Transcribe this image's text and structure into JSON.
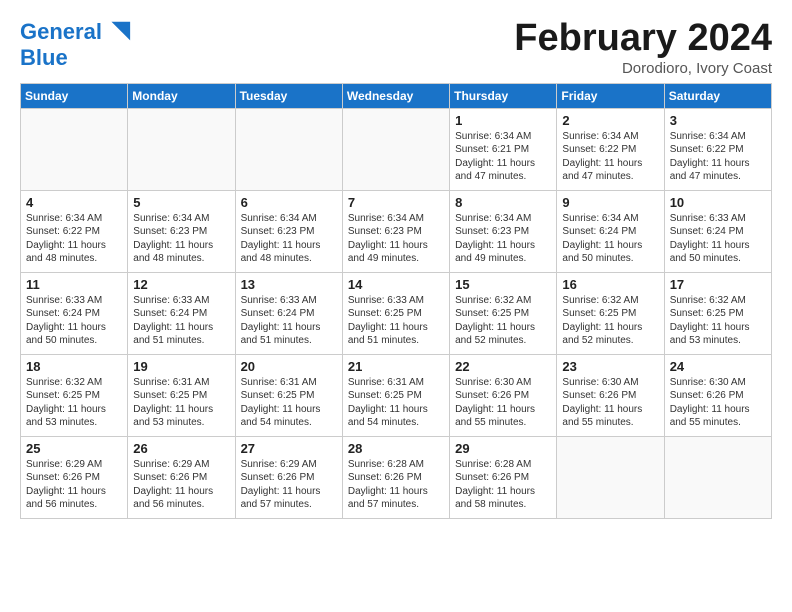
{
  "logo": {
    "line1": "General",
    "line2": "Blue"
  },
  "title": "February 2024",
  "subtitle": "Dorodioro, Ivory Coast",
  "headers": [
    "Sunday",
    "Monday",
    "Tuesday",
    "Wednesday",
    "Thursday",
    "Friday",
    "Saturday"
  ],
  "weeks": [
    [
      {
        "day": "",
        "info": ""
      },
      {
        "day": "",
        "info": ""
      },
      {
        "day": "",
        "info": ""
      },
      {
        "day": "",
        "info": ""
      },
      {
        "day": "1",
        "info": "Sunrise: 6:34 AM\nSunset: 6:21 PM\nDaylight: 11 hours\nand 47 minutes."
      },
      {
        "day": "2",
        "info": "Sunrise: 6:34 AM\nSunset: 6:22 PM\nDaylight: 11 hours\nand 47 minutes."
      },
      {
        "day": "3",
        "info": "Sunrise: 6:34 AM\nSunset: 6:22 PM\nDaylight: 11 hours\nand 47 minutes."
      }
    ],
    [
      {
        "day": "4",
        "info": "Sunrise: 6:34 AM\nSunset: 6:22 PM\nDaylight: 11 hours\nand 48 minutes."
      },
      {
        "day": "5",
        "info": "Sunrise: 6:34 AM\nSunset: 6:23 PM\nDaylight: 11 hours\nand 48 minutes."
      },
      {
        "day": "6",
        "info": "Sunrise: 6:34 AM\nSunset: 6:23 PM\nDaylight: 11 hours\nand 48 minutes."
      },
      {
        "day": "7",
        "info": "Sunrise: 6:34 AM\nSunset: 6:23 PM\nDaylight: 11 hours\nand 49 minutes."
      },
      {
        "day": "8",
        "info": "Sunrise: 6:34 AM\nSunset: 6:23 PM\nDaylight: 11 hours\nand 49 minutes."
      },
      {
        "day": "9",
        "info": "Sunrise: 6:34 AM\nSunset: 6:24 PM\nDaylight: 11 hours\nand 50 minutes."
      },
      {
        "day": "10",
        "info": "Sunrise: 6:33 AM\nSunset: 6:24 PM\nDaylight: 11 hours\nand 50 minutes."
      }
    ],
    [
      {
        "day": "11",
        "info": "Sunrise: 6:33 AM\nSunset: 6:24 PM\nDaylight: 11 hours\nand 50 minutes."
      },
      {
        "day": "12",
        "info": "Sunrise: 6:33 AM\nSunset: 6:24 PM\nDaylight: 11 hours\nand 51 minutes."
      },
      {
        "day": "13",
        "info": "Sunrise: 6:33 AM\nSunset: 6:24 PM\nDaylight: 11 hours\nand 51 minutes."
      },
      {
        "day": "14",
        "info": "Sunrise: 6:33 AM\nSunset: 6:25 PM\nDaylight: 11 hours\nand 51 minutes."
      },
      {
        "day": "15",
        "info": "Sunrise: 6:32 AM\nSunset: 6:25 PM\nDaylight: 11 hours\nand 52 minutes."
      },
      {
        "day": "16",
        "info": "Sunrise: 6:32 AM\nSunset: 6:25 PM\nDaylight: 11 hours\nand 52 minutes."
      },
      {
        "day": "17",
        "info": "Sunrise: 6:32 AM\nSunset: 6:25 PM\nDaylight: 11 hours\nand 53 minutes."
      }
    ],
    [
      {
        "day": "18",
        "info": "Sunrise: 6:32 AM\nSunset: 6:25 PM\nDaylight: 11 hours\nand 53 minutes."
      },
      {
        "day": "19",
        "info": "Sunrise: 6:31 AM\nSunset: 6:25 PM\nDaylight: 11 hours\nand 53 minutes."
      },
      {
        "day": "20",
        "info": "Sunrise: 6:31 AM\nSunset: 6:25 PM\nDaylight: 11 hours\nand 54 minutes."
      },
      {
        "day": "21",
        "info": "Sunrise: 6:31 AM\nSunset: 6:25 PM\nDaylight: 11 hours\nand 54 minutes."
      },
      {
        "day": "22",
        "info": "Sunrise: 6:30 AM\nSunset: 6:26 PM\nDaylight: 11 hours\nand 55 minutes."
      },
      {
        "day": "23",
        "info": "Sunrise: 6:30 AM\nSunset: 6:26 PM\nDaylight: 11 hours\nand 55 minutes."
      },
      {
        "day": "24",
        "info": "Sunrise: 6:30 AM\nSunset: 6:26 PM\nDaylight: 11 hours\nand 55 minutes."
      }
    ],
    [
      {
        "day": "25",
        "info": "Sunrise: 6:29 AM\nSunset: 6:26 PM\nDaylight: 11 hours\nand 56 minutes."
      },
      {
        "day": "26",
        "info": "Sunrise: 6:29 AM\nSunset: 6:26 PM\nDaylight: 11 hours\nand 56 minutes."
      },
      {
        "day": "27",
        "info": "Sunrise: 6:29 AM\nSunset: 6:26 PM\nDaylight: 11 hours\nand 57 minutes."
      },
      {
        "day": "28",
        "info": "Sunrise: 6:28 AM\nSunset: 6:26 PM\nDaylight: 11 hours\nand 57 minutes."
      },
      {
        "day": "29",
        "info": "Sunrise: 6:28 AM\nSunset: 6:26 PM\nDaylight: 11 hours\nand 58 minutes."
      },
      {
        "day": "",
        "info": ""
      },
      {
        "day": "",
        "info": ""
      }
    ]
  ]
}
